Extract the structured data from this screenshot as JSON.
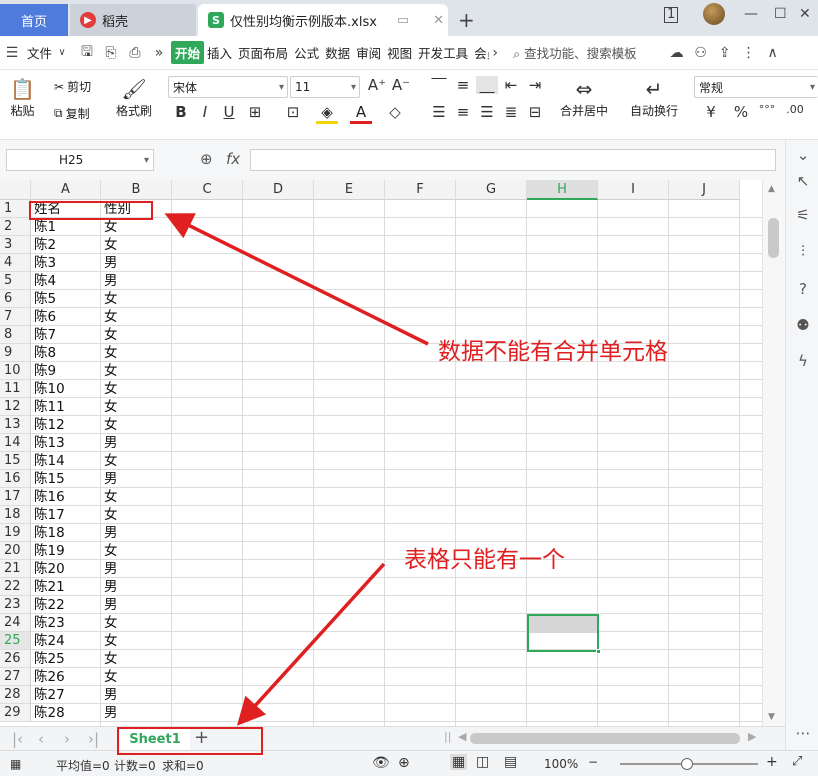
{
  "titlebar": {
    "home_tab": "首页",
    "daoke_tab": "稻壳",
    "file_tab": "仅性别均衡示例版本.xlsx",
    "add_tab": "+"
  },
  "menubar": {
    "file_menu": "文件",
    "items": [
      "开始",
      "插入",
      "页面布局",
      "公式",
      "数据",
      "审阅",
      "视图",
      "开发工具",
      "会员"
    ],
    "search": "查找功能、搜索模板"
  },
  "ribbon": {
    "paste": "粘贴",
    "cut": "剪切",
    "copy": "复制",
    "format_painter": "格式刷",
    "font_name": "宋体",
    "font_size": "11",
    "merge_center": "合并居中",
    "wrap_text": "自动换行",
    "number_format": "常规"
  },
  "formula_bar": {
    "cell_ref": "H25",
    "fx": "fx",
    "content": ""
  },
  "sheet": {
    "columns": [
      "A",
      "B",
      "C",
      "D",
      "E",
      "F",
      "G",
      "H",
      "I",
      "J"
    ],
    "active_column": "H",
    "active_row": 25,
    "rows": [
      [
        "1",
        "姓名",
        "性别"
      ],
      [
        "2",
        "陈1",
        "女"
      ],
      [
        "3",
        "陈2",
        "女"
      ],
      [
        "4",
        "陈3",
        "男"
      ],
      [
        "5",
        "陈4",
        "男"
      ],
      [
        "6",
        "陈5",
        "女"
      ],
      [
        "7",
        "陈6",
        "女"
      ],
      [
        "8",
        "陈7",
        "女"
      ],
      [
        "9",
        "陈8",
        "女"
      ],
      [
        "10",
        "陈9",
        "女"
      ],
      [
        "11",
        "陈10",
        "女"
      ],
      [
        "12",
        "陈11",
        "女"
      ],
      [
        "13",
        "陈12",
        "女"
      ],
      [
        "14",
        "陈13",
        "男"
      ],
      [
        "15",
        "陈14",
        "女"
      ],
      [
        "16",
        "陈15",
        "男"
      ],
      [
        "17",
        "陈16",
        "女"
      ],
      [
        "18",
        "陈17",
        "女"
      ],
      [
        "19",
        "陈18",
        "男"
      ],
      [
        "20",
        "陈19",
        "女"
      ],
      [
        "21",
        "陈20",
        "男"
      ],
      [
        "22",
        "陈21",
        "男"
      ],
      [
        "23",
        "陈22",
        "男"
      ],
      [
        "24",
        "陈23",
        "女"
      ],
      [
        "25",
        "陈24",
        "女"
      ],
      [
        "26",
        "陈25",
        "女"
      ],
      [
        "27",
        "陈26",
        "女"
      ],
      [
        "28",
        "陈27",
        "男"
      ],
      [
        "29",
        "陈28",
        "男"
      ]
    ]
  },
  "annotations": {
    "note1": "数据不能有合并单元格",
    "note2": "表格只能有一个",
    "color": "#e02020"
  },
  "sheet_tabs": {
    "active": "Sheet1",
    "add": "+"
  },
  "status": {
    "average": "平均值=0",
    "count": "计数=0",
    "sum": "求和=0",
    "zoom": "100%"
  },
  "colors": {
    "accent": "#2fa85a",
    "home_tab": "#4e7bdc"
  }
}
